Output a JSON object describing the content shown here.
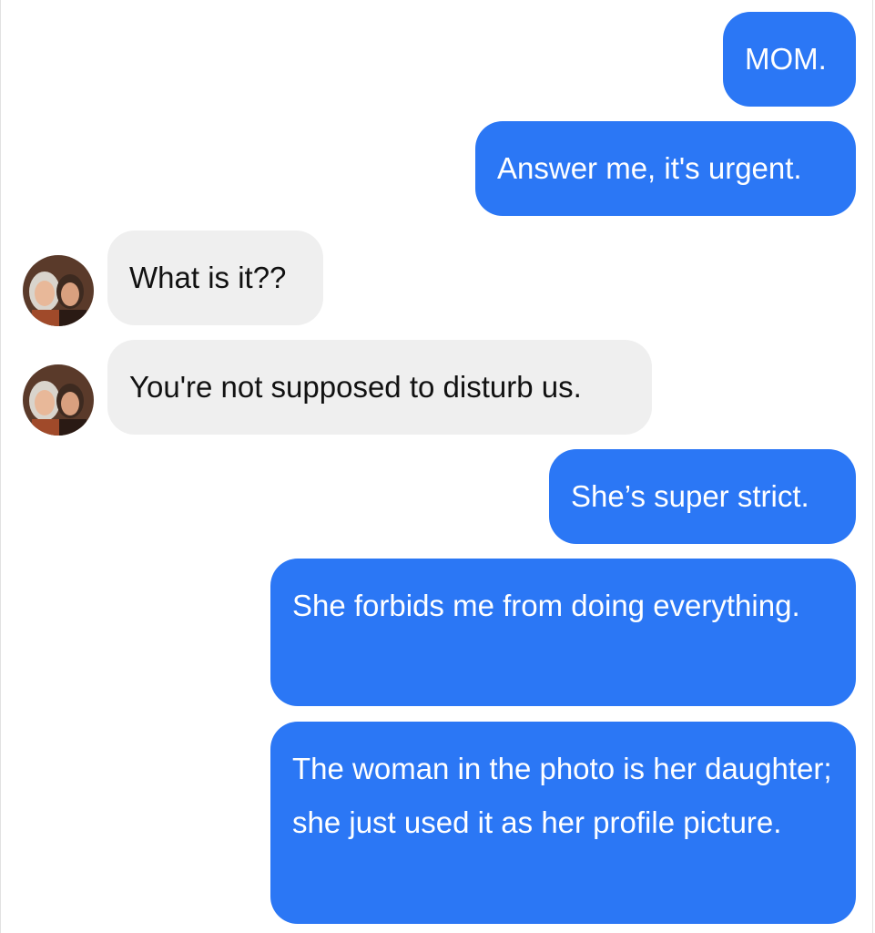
{
  "conversation": {
    "messages": [
      {
        "direction": "sent",
        "text": "MOM."
      },
      {
        "direction": "sent",
        "text": "Answer me, it's urgent."
      },
      {
        "direction": "received",
        "text": "What is it??"
      },
      {
        "direction": "received",
        "text": "You're not supposed to disturb us."
      },
      {
        "direction": "sent",
        "text": "She’s super strict."
      },
      {
        "direction": "sent",
        "text": "She forbids me from doing everything."
      },
      {
        "direction": "sent",
        "text": "The woman in the photo is her daughter; she just used it as her profile picture."
      }
    ],
    "colors": {
      "sent_bubble": "#2b77f5",
      "received_bubble": "#efefef",
      "sent_text": "#ffffff",
      "received_text": "#111111"
    },
    "avatar_icon": "contact-photo-avatar"
  }
}
